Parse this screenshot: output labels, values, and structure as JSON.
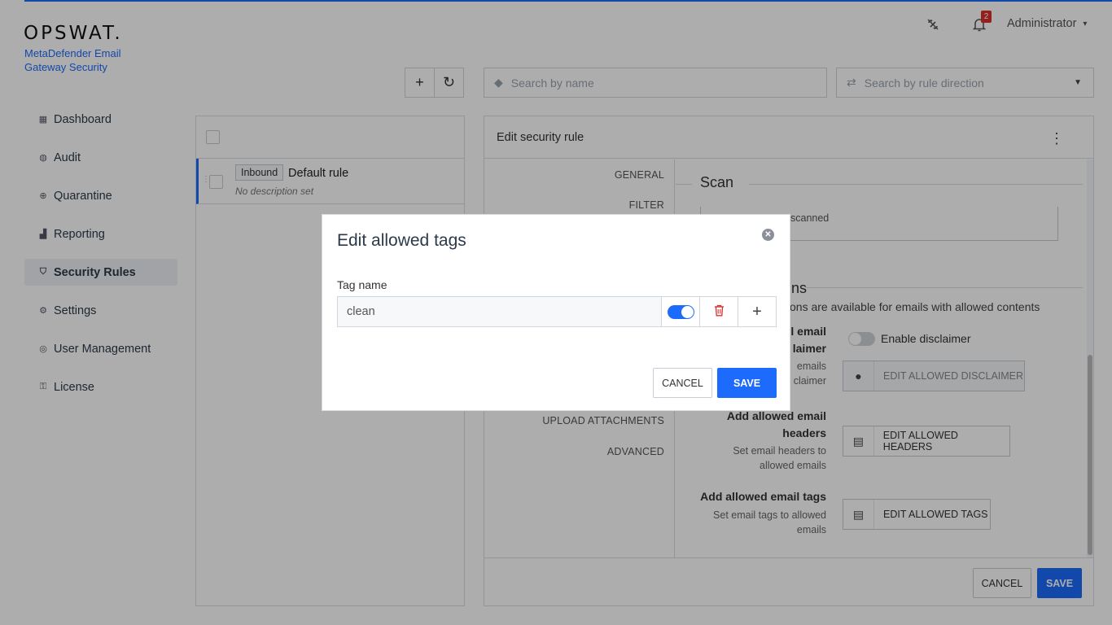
{
  "brand": {
    "logo": "OPSWAT.",
    "product": "MetaDefender Email Gateway Security"
  },
  "header": {
    "notification_count": "2",
    "user": "Administrator"
  },
  "sidebar": {
    "items": [
      {
        "label": "Dashboard",
        "icon": "dashboard-icon"
      },
      {
        "label": "Audit",
        "icon": "audit-icon"
      },
      {
        "label": "Quarantine",
        "icon": "quarantine-icon"
      },
      {
        "label": "Reporting",
        "icon": "reporting-icon"
      },
      {
        "label": "Security Rules",
        "icon": "shield-icon",
        "active": true
      },
      {
        "label": "Settings",
        "icon": "gear-icon"
      },
      {
        "label": "User Management",
        "icon": "user-icon"
      },
      {
        "label": "License",
        "icon": "license-icon"
      }
    ]
  },
  "toolbar": {
    "search_name_placeholder": "Search by name",
    "search_direction_placeholder": "Search by rule direction"
  },
  "rules": [
    {
      "direction": "Inbound",
      "name": "Default rule",
      "description": "No description set"
    }
  ],
  "edit": {
    "title": "Edit security rule",
    "tabs": [
      "GENERAL",
      "FILTER",
      "UPLOAD ATTACHMENTS",
      "ADVANCED"
    ],
    "scan_title": "Scan",
    "scan_box_text": "scanned",
    "section_title": "ns",
    "section_desc": "ons are available for emails with allowed contents",
    "disclaimer": {
      "label_line1": "l email",
      "label_line2": "laimer",
      "sub_line1": "emails",
      "sub_line2": "claimer",
      "toggle_label": "Enable disclaimer",
      "button": "EDIT ALLOWED DISCLAIMER"
    },
    "headers": {
      "label_line1": "Add allowed email",
      "label_line2": "headers",
      "sub_line1": "Set email headers to",
      "sub_line2": "allowed emails",
      "button": "EDIT ALLOWED HEADERS"
    },
    "tags": {
      "label_line1": "Add allowed email tags",
      "sub_line1": "Set email tags to allowed",
      "sub_line2": "emails",
      "button": "EDIT ALLOWED TAGS"
    },
    "cancel": "CANCEL",
    "save": "SAVE"
  },
  "modal": {
    "title": "Edit allowed tags",
    "field_label": "Tag name",
    "tag_value": "clean",
    "tag_enabled": true,
    "cancel": "CANCEL",
    "save": "SAVE"
  },
  "colors": {
    "accent": "#1d6bfc",
    "danger": "#d9302c"
  }
}
